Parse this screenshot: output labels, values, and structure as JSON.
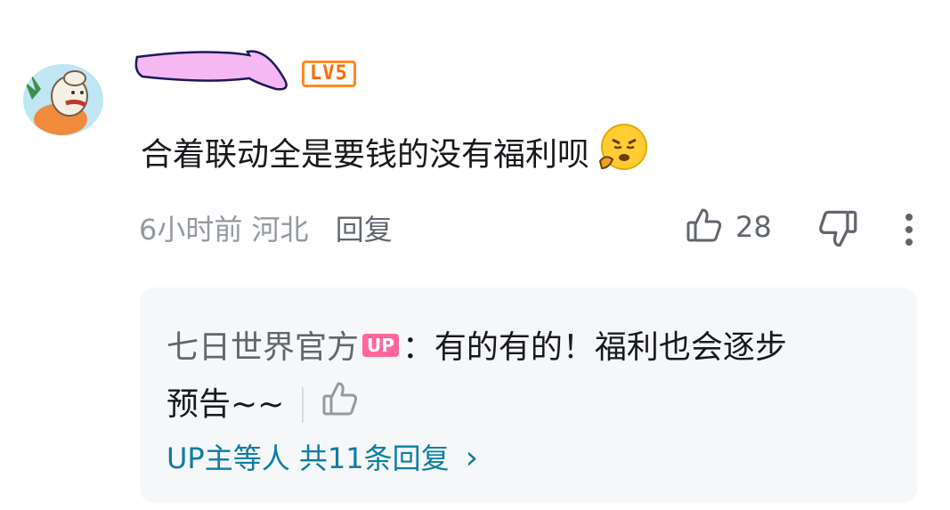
{
  "comment": {
    "level_badge": "LV5",
    "text": "合着联动全是要钱的没有福利呗",
    "emoji": "sneeze-emoji",
    "time": "6小时前",
    "location": "河北",
    "reply_label": "回复",
    "like_count": "28"
  },
  "reply": {
    "author": "七日世界官方",
    "up_badge": "UP",
    "text_part1": "：有的有的！福利也会逐步",
    "text_part2": "预告~~",
    "more_label": "UP主等人 共11条回复",
    "more_chevron": "›"
  },
  "colors": {
    "accent_link": "#0a7ea4",
    "level_orange": "#ff6a00",
    "up_pink": "#ff6699",
    "meta_gray": "#9499a0"
  }
}
